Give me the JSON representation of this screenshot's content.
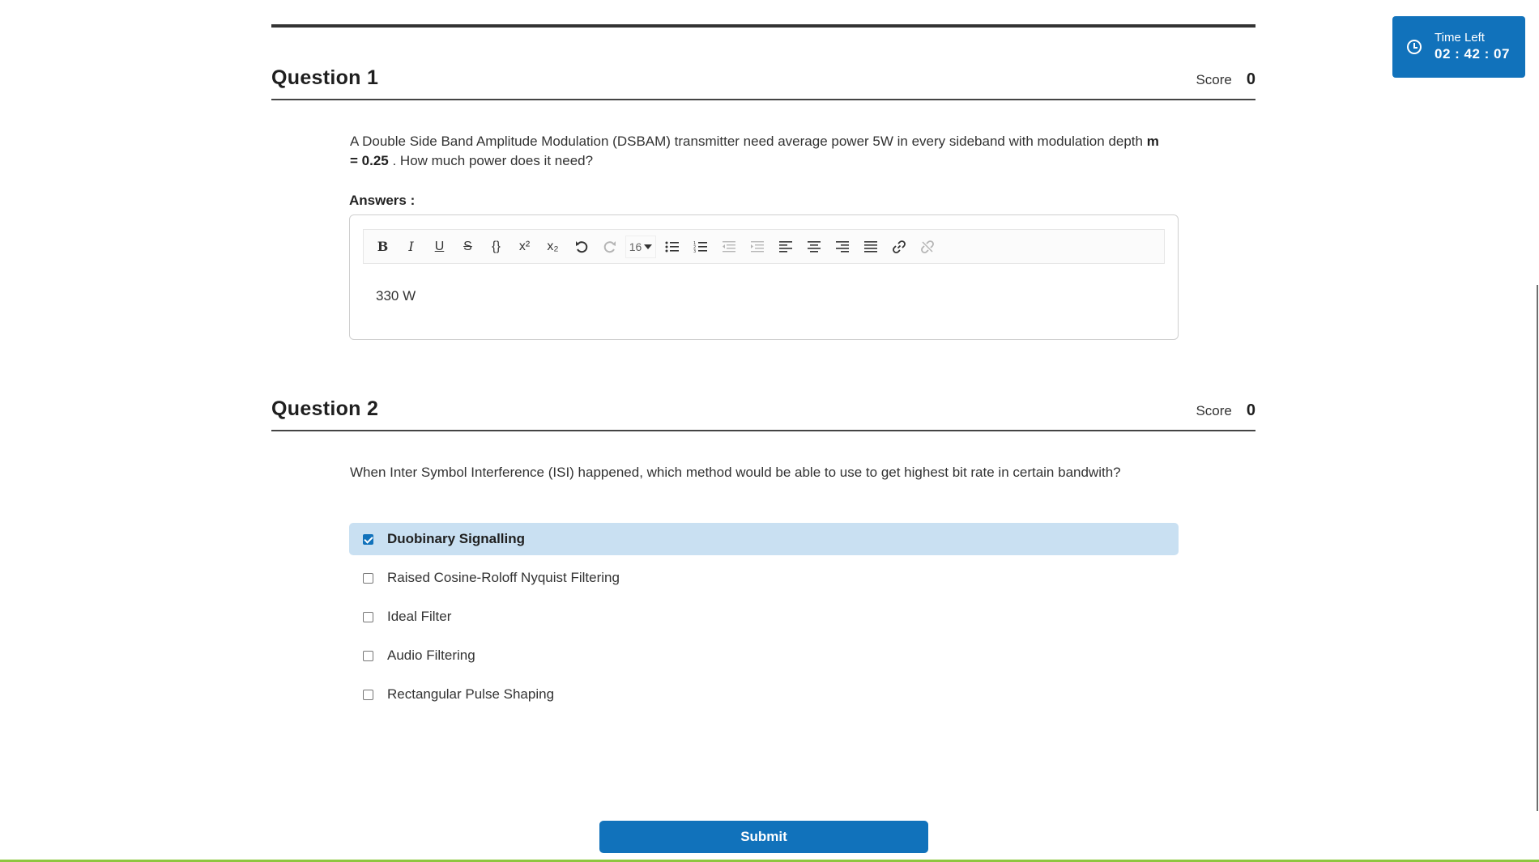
{
  "timer": {
    "label": "Time Left",
    "value": "02 : 42 : 07",
    "icon": "clock-icon"
  },
  "questions": [
    {
      "title": "Question 1",
      "score_label": "Score",
      "score_value": "0",
      "text_before": "A Double Side Band Amplitude Modulation (DSBAM) transmitter need average power 5W in every sideband with modulation depth ",
      "text_bold": "m = 0.25",
      "text_after": " . How much power does it need?",
      "answers_label": "Answers :",
      "answer_value": "330 W"
    },
    {
      "title": "Question 2",
      "score_label": "Score",
      "score_value": "0",
      "text": "When Inter Symbol Interference (ISI) happened, which method would be able to use to get highest bit rate in certain bandwith?",
      "options": [
        {
          "label": "Duobinary Signalling",
          "checked": true
        },
        {
          "label": "Raised Cosine-Roloff Nyquist Filtering",
          "checked": false
        },
        {
          "label": "Ideal Filter",
          "checked": false
        },
        {
          "label": "Audio Filtering",
          "checked": false
        },
        {
          "label": "Rectangular Pulse Shaping",
          "checked": false
        }
      ]
    }
  ],
  "editor_toolbar": {
    "bold": "B",
    "italic": "I",
    "underline": "U",
    "strike": "S",
    "code": "{}",
    "superscript": "x²",
    "subscript": "x₂",
    "font_size": "16",
    "icons": [
      "bold-icon",
      "italic-icon",
      "underline-icon",
      "strikethrough-icon",
      "code-icon",
      "superscript-icon",
      "subscript-icon",
      "undo-icon",
      "redo-icon",
      "font-size-select",
      "bullet-list-icon",
      "numbered-list-icon",
      "outdent-icon",
      "indent-icon",
      "align-left-icon",
      "align-center-icon",
      "align-right-icon",
      "justify-icon",
      "link-icon",
      "unlink-icon"
    ]
  },
  "submit_label": "Submit",
  "colors": {
    "primary": "#1172bb",
    "selected_bg": "#c9e0f2",
    "accent_line": "#8dc63f"
  }
}
